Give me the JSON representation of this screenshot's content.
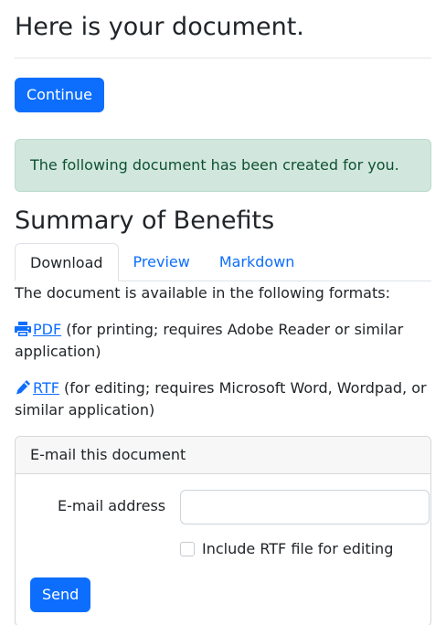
{
  "page": {
    "title": "Here is your document.",
    "continue_label": "Continue",
    "alert_text": "The following document has been created for you.",
    "document_title": "Summary of Benefits"
  },
  "tabs": [
    {
      "label": "Download",
      "active": true
    },
    {
      "label": "Preview",
      "active": false
    },
    {
      "label": "Markdown",
      "active": false
    }
  ],
  "download": {
    "intro": "The document is available in the following formats:",
    "formats": [
      {
        "icon": "printer-icon",
        "link": "PDF",
        "note": " (for printing; requires Adobe Reader or similar application)"
      },
      {
        "icon": "pencil-icon",
        "link": "RTF",
        "note": " (for editing; requires Microsoft Word, Wordpad, or similar application)"
      }
    ]
  },
  "email_card": {
    "header": "E-mail this document",
    "email_label": "E-mail address",
    "email_value": "",
    "checkbox_label": "Include RTF file for editing",
    "checkbox_checked": false,
    "send_label": "Send"
  },
  "colors": {
    "primary": "#0d6efd",
    "alert_bg": "#d1e7dd",
    "alert_text": "#0f5132"
  }
}
